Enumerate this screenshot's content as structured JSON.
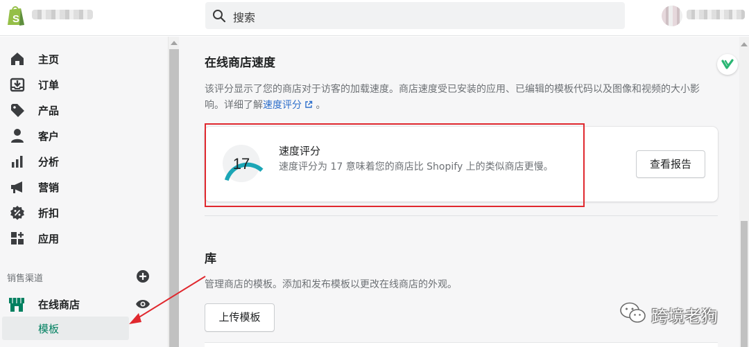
{
  "topbar": {
    "search_placeholder": "搜索",
    "logo_icon": "shopify-bag-icon"
  },
  "sidebar": {
    "items": [
      {
        "label": "主页",
        "icon": "home-icon"
      },
      {
        "label": "订单",
        "icon": "orders-icon"
      },
      {
        "label": "产品",
        "icon": "tag-icon"
      },
      {
        "label": "客户",
        "icon": "person-icon"
      },
      {
        "label": "分析",
        "icon": "bar-chart-icon"
      },
      {
        "label": "营销",
        "icon": "megaphone-icon"
      },
      {
        "label": "折扣",
        "icon": "discount-icon"
      },
      {
        "label": "应用",
        "icon": "apps-icon"
      }
    ],
    "sales_channels_title": "销售渠道",
    "online_store_label": "在线商店",
    "themes_label": "模板"
  },
  "main": {
    "speed_section": {
      "title": "在线商店速度",
      "description": "该评分显示了您的商店对于访客的加载速度。商店速度受已安装的应用、已编辑的模板代码以及图像和视频的大小影响。详细了解",
      "link_text": "速度评分",
      "description_end": "。",
      "score": "17",
      "score_fraction": 0.45,
      "score_title": "速度评分",
      "score_description": "速度评分为 17 意味着您的商店比 Shopify 上的类似商店更慢。",
      "report_button": "查看报告"
    },
    "library_section": {
      "title": "库",
      "description": "管理商店的模板。添加和发布模板以更改在线商店的外观。",
      "upload_button": "上传模板"
    }
  },
  "watermark": {
    "text": "跨境老狗"
  },
  "colors": {
    "brand_green": "#008060",
    "gauge_teal": "#1ba6b6",
    "annotation_red": "#e0282e",
    "link_blue": "#2c6ecb"
  }
}
